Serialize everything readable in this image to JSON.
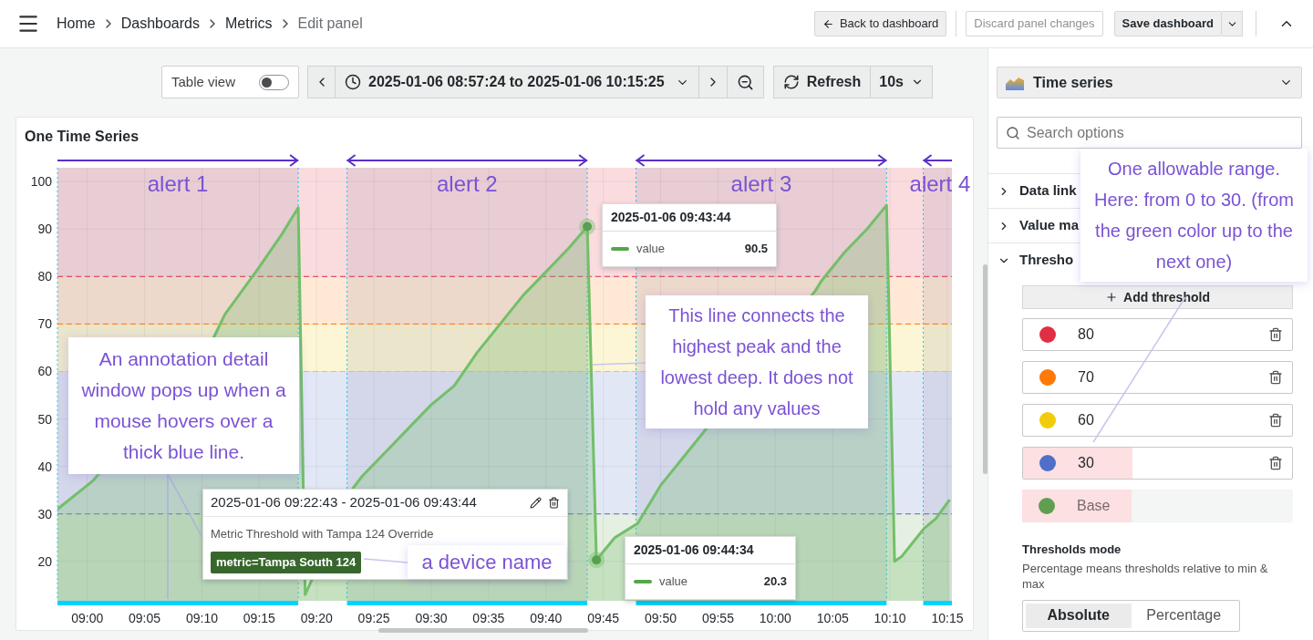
{
  "topbar": {
    "breadcrumbs": [
      {
        "label": "Home",
        "current": false
      },
      {
        "label": "Dashboards",
        "current": false
      },
      {
        "label": "Metrics",
        "current": false
      },
      {
        "label": "Edit panel",
        "current": true
      }
    ],
    "back_button": "Back to dashboard",
    "discard_button": {
      "label": "Discard panel changes",
      "disabled": true
    },
    "save_button": "Save dashboard"
  },
  "toolbar": {
    "table_view": {
      "label": "Table view",
      "on": false
    },
    "time_range": "2025-01-06 08:57:24 to 2025-01-06 10:15:25",
    "refresh": "Refresh",
    "interval": "10s"
  },
  "panel": {
    "title": "One Time Series",
    "chart_data": {
      "type": "area",
      "grid": true,
      "xlim": [
        537.4,
        615.4
      ],
      "ylim": [
        11.7,
        102.9
      ],
      "xticks": [
        {
          "value": 540,
          "label": "09:00"
        },
        {
          "value": 545,
          "label": "09:05"
        },
        {
          "value": 550,
          "label": "09:10"
        },
        {
          "value": 555,
          "label": "09:15"
        },
        {
          "value": 560,
          "label": "09:20"
        },
        {
          "value": 565,
          "label": "09:25"
        },
        {
          "value": 570,
          "label": "09:30"
        },
        {
          "value": 575,
          "label": "09:35"
        },
        {
          "value": 580,
          "label": "09:40"
        },
        {
          "value": 585,
          "label": "09:45"
        },
        {
          "value": 590,
          "label": "09:50"
        },
        {
          "value": 595,
          "label": "09:55"
        },
        {
          "value": 600,
          "label": "10:00"
        },
        {
          "value": 605,
          "label": "10:05"
        },
        {
          "value": 610,
          "label": "10:10"
        },
        {
          "value": 615,
          "label": "10:15"
        }
      ],
      "yticks": [
        20,
        30,
        40,
        50,
        60,
        70,
        80,
        90,
        100
      ],
      "x": [
        537.4,
        540,
        540.5,
        551,
        552,
        555,
        557,
        558.4,
        559.0,
        563.2,
        564,
        566,
        568,
        570,
        572,
        574,
        576,
        578,
        580,
        582,
        583.6,
        584.4,
        586,
        588,
        590,
        592,
        593.5,
        603.5,
        604,
        606,
        608,
        609.7,
        610.4,
        611,
        613,
        614,
        615.2
      ],
      "series": [
        {
          "name": "value",
          "color": "#73bf69",
          "values": [
            31,
            36,
            37,
            67,
            72,
            82,
            89,
            94.5,
            13,
            35.5,
            38,
            43,
            48,
            53,
            57,
            64,
            70,
            76,
            81,
            86,
            90.5,
            20.3,
            25,
            28,
            36,
            42,
            46.5,
            77,
            79,
            85,
            90,
            95,
            20,
            21,
            27,
            29,
            33
          ]
        }
      ],
      "ref_lines": [
        {
          "axis": "x",
          "value": 537.4,
          "color": "#19c6f0"
        },
        {
          "axis": "x",
          "value": 558.4,
          "color": "#19c6f0"
        },
        {
          "axis": "x",
          "value": 562.65,
          "color": "#19c6f0"
        },
        {
          "axis": "x",
          "value": 583.6,
          "color": "#19c6f0"
        },
        {
          "axis": "x",
          "value": 587.85,
          "color": "#19c6f0"
        },
        {
          "axis": "x",
          "value": 609.7,
          "color": "#19c6f0"
        },
        {
          "axis": "x",
          "value": 612.9,
          "color": "#19c6f0"
        },
        {
          "axis": "y",
          "value": 30,
          "color": "#5470cc"
        },
        {
          "axis": "y",
          "value": 60,
          "color": "#f2cc0c"
        },
        {
          "axis": "y",
          "value": 70,
          "color": "#ff780a"
        },
        {
          "axis": "y",
          "value": 80,
          "color": "#e02f44"
        }
      ],
      "bands": [
        {
          "axis": "y",
          "from": 11.7,
          "to": 30,
          "color": "#629e51"
        },
        {
          "axis": "y",
          "from": 30,
          "to": 60,
          "color": "#5470cc"
        },
        {
          "axis": "y",
          "from": 60,
          "to": 70,
          "color": "#f2cc0c"
        },
        {
          "axis": "y",
          "from": 70,
          "to": 80,
          "color": "#ff780a"
        },
        {
          "axis": "y",
          "from": 80,
          "to": 102.9,
          "color": "#e02f44"
        },
        {
          "axis": "x",
          "from": 537.4,
          "to": 558.4,
          "label": "alert 1",
          "color": "#4b4a7a"
        },
        {
          "axis": "x",
          "from": 562.65,
          "to": 583.6,
          "label": "alert 2",
          "color": "#4b4a7a"
        },
        {
          "axis": "x",
          "from": 587.85,
          "to": 609.7,
          "label": "alert 3",
          "color": "#4b4a7a"
        },
        {
          "axis": "x",
          "from": 612.9,
          "to": 615.4,
          "label": "alert 4",
          "color": "#4b4a7a"
        }
      ],
      "annotations": [
        {
          "x": 583.6,
          "y": 90.5,
          "text": "2025-01-06 09:43:44"
        },
        {
          "x": 584.4,
          "y": 20.3,
          "text": "2025-01-06 09:44:34"
        }
      ]
    },
    "tooltips": [
      {
        "value": "90.5"
      },
      {
        "value": "20.3"
      }
    ],
    "annotation_popup": {
      "time": "2025-01-06 09:22:43 - 2025-01-06 09:43:44",
      "text": "Metric Threshold with Tampa 124 Override",
      "tag": "metric=Tampa South 124"
    }
  },
  "options": {
    "visualization": "Time series",
    "search": {
      "placeholder": "Search options"
    },
    "sections": [
      {
        "label": "Data link",
        "expanded": false
      },
      {
        "label": "Value ma",
        "expanded": false
      },
      {
        "label": "Thresho",
        "expanded": true
      }
    ],
    "add_threshold": "Add threshold",
    "thresholds": [
      {
        "kind": "step",
        "value": "80",
        "color": "#e02f44",
        "highlighted": false
      },
      {
        "kind": "step",
        "value": "70",
        "color": "#ff780a",
        "highlighted": false
      },
      {
        "kind": "step",
        "value": "60",
        "color": "#f2cc0c",
        "highlighted": false
      },
      {
        "kind": "step",
        "value": "30",
        "color": "#4f6fcb",
        "highlighted": true
      },
      {
        "kind": "base",
        "value": "Base",
        "color": "#629e51",
        "highlighted": true
      }
    ],
    "mode": {
      "title": "Thresholds mode",
      "description": "Percentage means thresholds relative to min & max",
      "options": [
        {
          "label": "Absolute",
          "selected": true
        },
        {
          "label": "Percentage",
          "selected": false
        }
      ]
    }
  },
  "callouts": [
    {
      "text": "An annotation detail window pops up when a mouse hovers over a thick blue line."
    },
    {
      "text": "a device name"
    },
    {
      "text": "This line connects the highest peak and the lowest deep. It does not hold any values"
    },
    {
      "text": "One allowable range. Here: from 0 to 30. (from the green color up to the next one)"
    }
  ]
}
